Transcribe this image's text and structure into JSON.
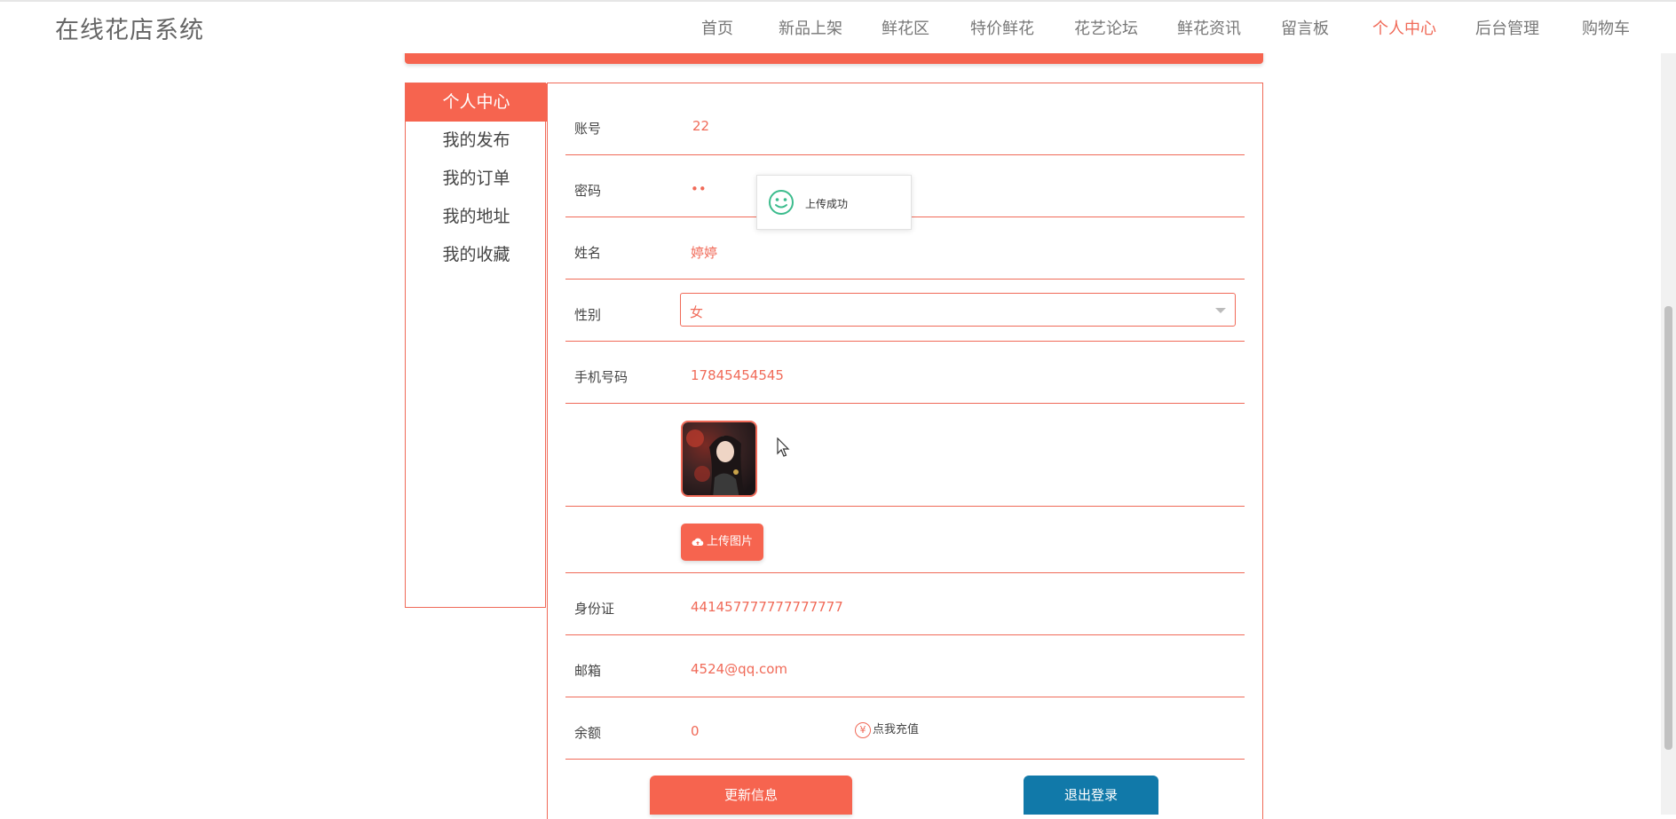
{
  "brand": "在线花店系统",
  "nav": [
    "首页",
    "新品上架",
    "鲜花区",
    "特价鲜花",
    "花艺论坛",
    "鲜花资讯",
    "留言板",
    "个人中心",
    "后台管理",
    "购物车"
  ],
  "nav_active": "个人中心",
  "accent": "#f6644f",
  "secondary": "#1179a9",
  "sidebar": {
    "items": [
      "个人中心",
      "我的发布",
      "我的订单",
      "我的地址",
      "我的收藏"
    ]
  },
  "form": {
    "account_label": "账号",
    "account_value": "22",
    "password_label": "密码",
    "password_value": "••",
    "name_label": "姓名",
    "name_value": "婷婷",
    "gender_label": "性别",
    "gender_value": "女",
    "phone_label": "手机号码",
    "phone_value": "17845454545",
    "upload_label": "上传图片",
    "id_label": "身份证",
    "id_value": "441457777777777777",
    "email_label": "邮箱",
    "email_value": "4524@qq.com",
    "balance_label": "余额",
    "balance_value": "0",
    "recharge_label": "点我充值",
    "recharge_icon": "¥"
  },
  "buttons": {
    "update": "更新信息",
    "logout": "退出登录"
  },
  "toast": {
    "message": "上传成功",
    "icon": "smile-icon"
  }
}
